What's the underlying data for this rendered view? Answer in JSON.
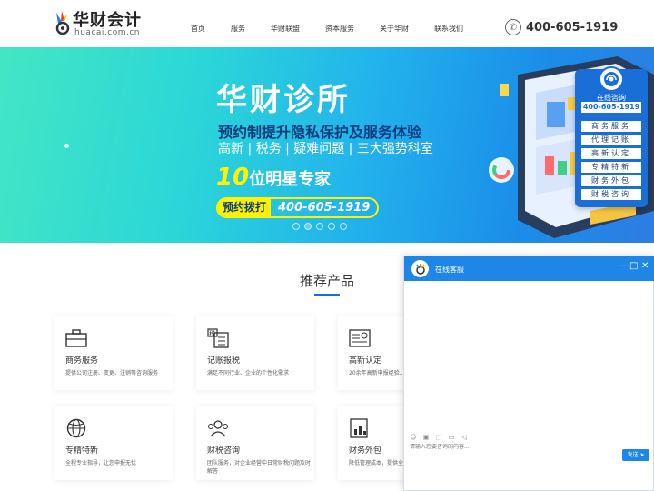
{
  "header": {
    "logo_cn": "华财会计",
    "logo_en": "huacai.com.cn",
    "nav": [
      "首页",
      "服务",
      "华财联盟",
      "资本服务",
      "关于华财",
      "联系我们"
    ],
    "phone": "400-605-1919",
    "phone_icon": "phone-icon"
  },
  "banner": {
    "title": "华财诊所",
    "subtitle1": "预约制提升隐私保护及服务体验",
    "subtitle2": "高新 | 税务 | 疑难问题 | 三大强势科室",
    "expert_num": "10",
    "expert_text": "位明星专家",
    "cta_label": "预约拨打",
    "cta_phone": "400-605-1919",
    "carousel_total": 5,
    "carousel_active": 2
  },
  "side_panel": {
    "title": "在线咨询",
    "phone": "400-605-1919",
    "items": [
      "商务服务",
      "代理记账",
      "高新认定",
      "专精特新",
      "财务外包",
      "财税咨询"
    ]
  },
  "products": {
    "title": "推荐产品",
    "cards": [
      {
        "name": "商务服务",
        "desc": "提供公司注册、变更、注销等咨询服务",
        "icon": "briefcase-icon"
      },
      {
        "name": "记账报税",
        "desc": "满足不同行业、企业的个性化需求",
        "icon": "tax-document-icon"
      },
      {
        "name": "高新认定",
        "desc": "20余年高新申报经验...",
        "icon": "certificate-icon"
      },
      {
        "name": "专精特新",
        "desc": "全程专业指导，让您申报无忧",
        "icon": "globe-icon"
      },
      {
        "name": "财税咨询",
        "desc": "团队服务，对企业经营中日常财税问题及时解答",
        "icon": "team-icon"
      },
      {
        "name": "财务外包",
        "desc": "降低管理成本，提供全...",
        "icon": "chart-report-icon"
      }
    ]
  },
  "chat": {
    "title": "在线客服",
    "placeholder": "请输入您要咨询的内容...",
    "send_label": "发送",
    "send_icon": "send-arrow-icon",
    "controls": [
      "—",
      "□",
      "✕"
    ]
  },
  "colors": {
    "primary": "#1e86e6",
    "accent_yellow": "#fff200",
    "banner_start": "#43e6c4",
    "banner_end": "#2d7de2"
  }
}
